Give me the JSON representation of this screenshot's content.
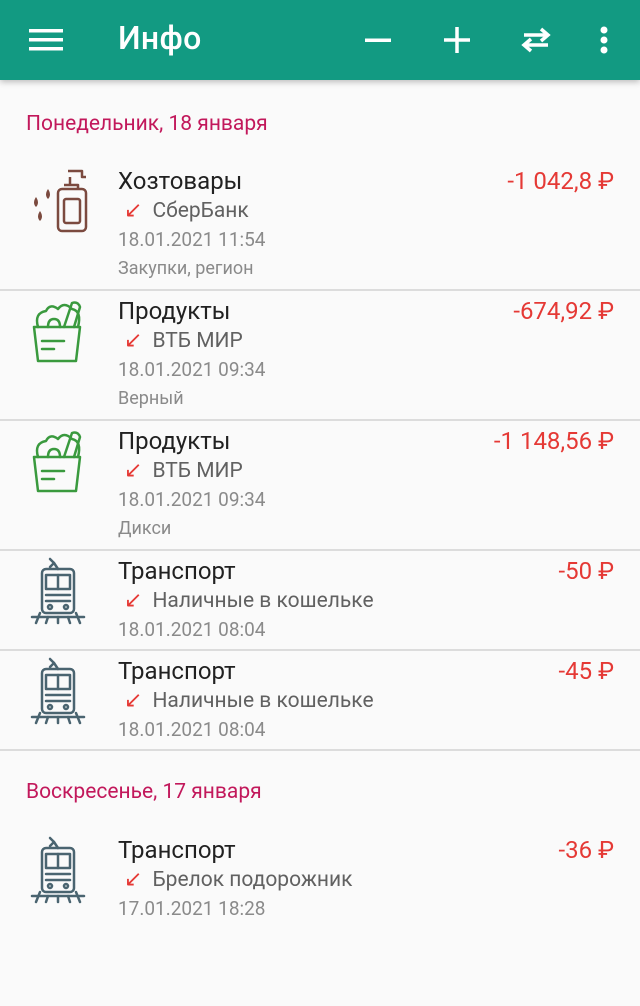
{
  "header": {
    "title": "Инфо",
    "icons": {
      "menu": "menu-icon",
      "minus": "minus-icon",
      "plus": "plus-icon",
      "swap": "swap-icon",
      "more": "more-vert-icon"
    },
    "bg_color": "#129a82"
  },
  "groups": [
    {
      "date_label": "Понедельник, 18 января",
      "transactions": [
        {
          "category": "Хозтовары",
          "amount": "-1 042,8 ₽",
          "account": "СберБанк",
          "datetime": "18.01.2021 11:54",
          "note": "Закупки, регион",
          "icon": "household-spray-icon"
        },
        {
          "category": "Продукты",
          "amount": "-674,92 ₽",
          "account": "ВТБ МИР",
          "datetime": "18.01.2021 09:34",
          "note": "Верный",
          "icon": "grocery-bag-icon"
        },
        {
          "category": "Продукты",
          "amount": "-1 148,56 ₽",
          "account": "ВТБ МИР",
          "datetime": "18.01.2021 09:34",
          "note": "Дикси",
          "icon": "grocery-bag-icon"
        },
        {
          "category": "Транспорт",
          "amount": "-50 ₽",
          "account": "Наличные в кошельке",
          "datetime": "18.01.2021 08:04",
          "note": "",
          "icon": "train-icon"
        },
        {
          "category": "Транспорт",
          "amount": "-45 ₽",
          "account": "Наличные в кошельке",
          "datetime": "18.01.2021 08:04",
          "note": "",
          "icon": "train-icon"
        }
      ]
    },
    {
      "date_label": "Воскресенье, 17 января",
      "transactions": [
        {
          "category": "Транспорт",
          "amount": "-36 ₽",
          "account": "Брелок подорожник",
          "datetime": "17.01.2021 18:28",
          "note": "",
          "icon": "train-icon"
        }
      ]
    }
  ],
  "colors": {
    "expense": "#e53935",
    "date_header": "#c2185b"
  }
}
